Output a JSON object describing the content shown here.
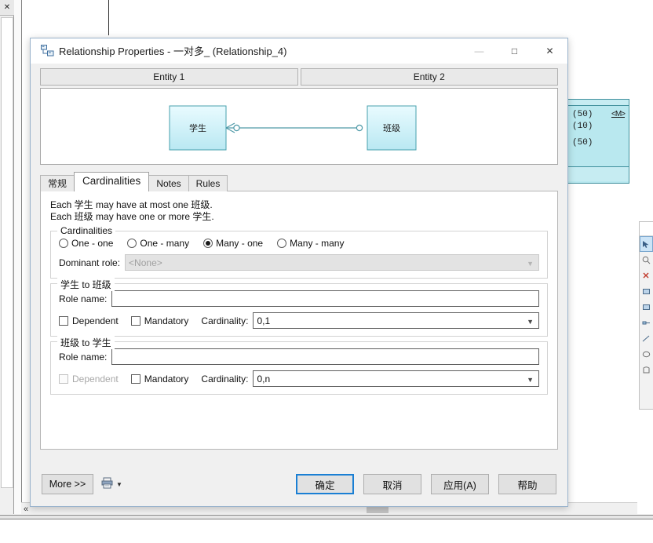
{
  "window": {
    "title": "Relationship Properties - 一对多_ (Relationship_4)",
    "icon": "relationship-icon",
    "minimize_label": "—",
    "maximize_label": "□",
    "close_label": "✕"
  },
  "entity_headers": {
    "entity1_label": "Entity 1",
    "entity2_label": "Entity 2"
  },
  "diagram": {
    "left_entity": "学生",
    "right_entity": "班级",
    "entity_fill": "#d9f3fa",
    "entity_border": "#47a0ad",
    "link_color": "#4f9aa8"
  },
  "tabs": [
    {
      "label": "常规",
      "active": false
    },
    {
      "label": "Cardinalities",
      "active": true
    },
    {
      "label": "Notes",
      "active": false
    },
    {
      "label": "Rules",
      "active": false
    }
  ],
  "description": {
    "line1": "Each 学生 may have at most one 班级.",
    "line2": "Each 班级 may have one or more 学生."
  },
  "cardinalities_group": {
    "legend": "Cardinalities",
    "options": [
      {
        "label": "One - one",
        "selected": false
      },
      {
        "label": "One - many",
        "selected": false
      },
      {
        "label": "Many - one",
        "selected": true
      },
      {
        "label": "Many - many",
        "selected": false
      }
    ],
    "dominant_role_label": "Dominant role:",
    "dominant_role_value": "<None>",
    "dominant_role_disabled": true
  },
  "group_a": {
    "legend": "学生 to 班级",
    "role_name_label": "Role name:",
    "role_name_value": "",
    "dependent_label": "Dependent",
    "dependent_checked": false,
    "dependent_disabled": false,
    "mandatory_label": "Mandatory",
    "mandatory_checked": false,
    "cardinality_label": "Cardinality:",
    "cardinality_value": "0,1"
  },
  "group_b": {
    "legend": "班级 to 学生",
    "role_name_label": "Role name:",
    "role_name_value": "",
    "dependent_label": "Dependent",
    "dependent_checked": false,
    "dependent_disabled": true,
    "mandatory_label": "Mandatory",
    "mandatory_checked": false,
    "cardinality_label": "Cardinality:",
    "cardinality_value": "0,n"
  },
  "footer": {
    "more_label": "More >>",
    "print_icon": "printer-icon",
    "print_dropdown": "▼",
    "ok_label": "确定",
    "cancel_label": "取消",
    "apply_label": "应用(A)",
    "help_label": "帮助",
    "accent_color": "#1a7fd4"
  },
  "background": {
    "er_entity": {
      "line1": "(50)",
      "line2": "(10)",
      "line3": "(50)",
      "marker": "<M>"
    },
    "far_left_close": "✕",
    "scroll_left_chevron": "«"
  }
}
